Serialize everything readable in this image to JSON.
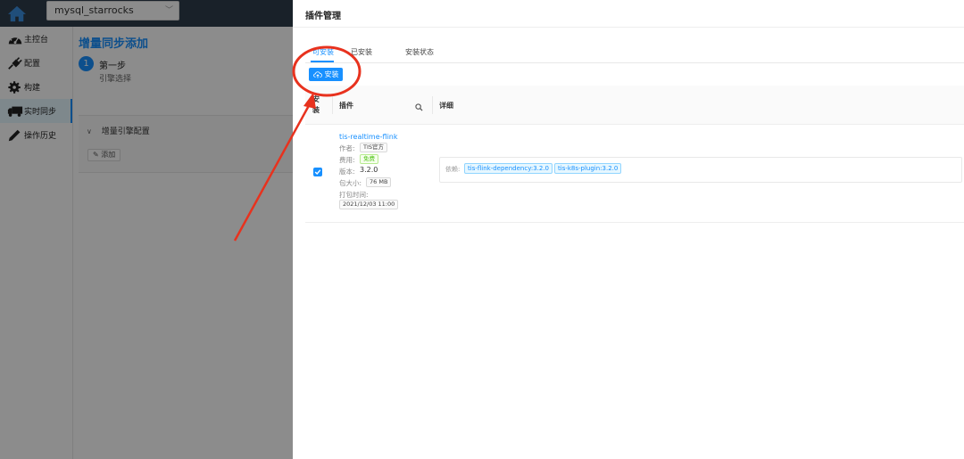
{
  "topbar": {
    "db_name": "mysql_starrocks"
  },
  "sidebar": {
    "items": [
      {
        "label": "主控台",
        "icon": "dashboard-icon"
      },
      {
        "label": "配置",
        "icon": "plug-icon"
      },
      {
        "label": "构建",
        "icon": "gear-icon"
      },
      {
        "label": "实时同步",
        "icon": "truck-icon",
        "active": true
      },
      {
        "label": "操作历史",
        "icon": "pencil-icon"
      }
    ]
  },
  "main": {
    "title": "增量同步添加",
    "step": {
      "number": "1",
      "title": "第一步",
      "desc": "引擎选择"
    },
    "panel": {
      "title": "增量引擎配置",
      "add_label": "添加"
    }
  },
  "drawer": {
    "title": "插件管理",
    "tabs": [
      "可安装",
      "已安装",
      "安装状态"
    ],
    "active_tab": 0,
    "install_label": "安装",
    "columns": {
      "install": "安装",
      "plugin": "插件",
      "detail": "详细"
    },
    "plugin": {
      "name": "tis-realtime-flink",
      "author_label": "作者:",
      "author": "TIS官方",
      "fee_label": "费用:",
      "fee": "免费",
      "version_label": "版本:",
      "version": "3.2.0",
      "size_label": "包大小:",
      "size": "76 MB",
      "build_time_label": "打包时间:",
      "build_time": "2021/12/03 11:00",
      "checked": true,
      "dependency_label": "依赖:",
      "dependencies": [
        "tis-flink-dependency:3.2.0",
        "tis-k8s-plugin:3.2.0"
      ]
    }
  },
  "colors": {
    "accent": "#1890ff",
    "annotation": "#e8321e",
    "topbar": "#2f3d4c"
  }
}
